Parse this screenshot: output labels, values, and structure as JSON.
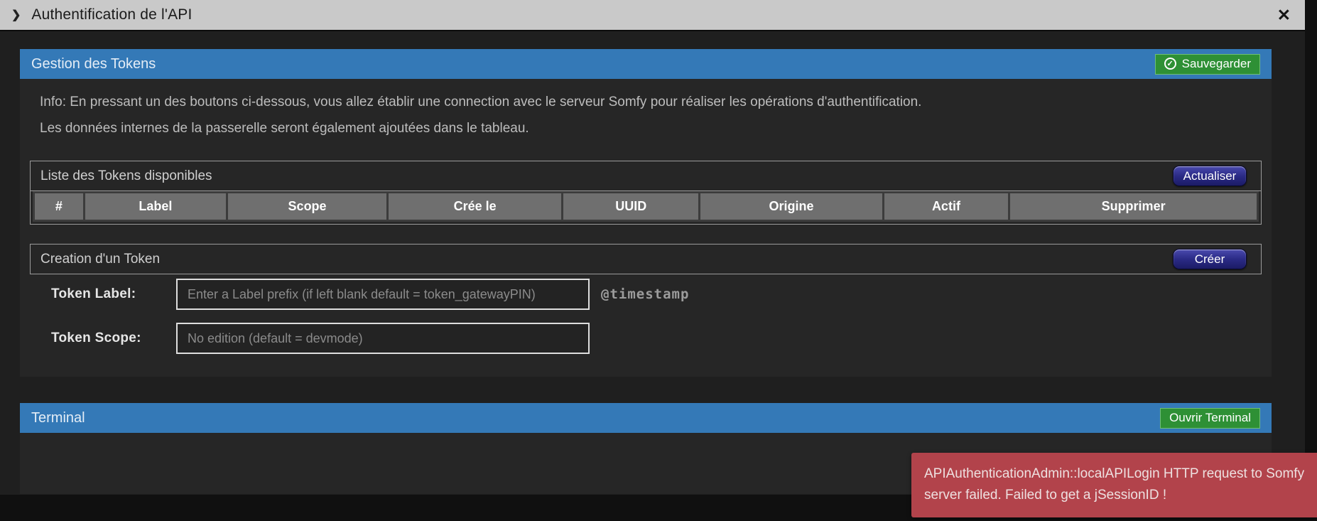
{
  "titlebar": {
    "title": "Authentification de l'API",
    "chevron_icon": "❯",
    "close_icon": "✕"
  },
  "panels": {
    "tokens": {
      "title": "Gestion des Tokens",
      "save_button": "Sauvegarder",
      "check_icon": "✓",
      "info_line1": "Info: En pressant un des boutons ci-dessous, vous allez établir une connection avec le serveur Somfy pour réaliser les opérations d'authentification.",
      "info_line2": "Les données internes de la passerelle seront également ajoutées dans le tableau.",
      "list": {
        "title": "Liste des Tokens disponibles",
        "refresh_button": "Actualiser",
        "columns": [
          "#",
          "Label",
          "Scope",
          "Crée le",
          "UUID",
          "Origine",
          "Actif",
          "Supprimer"
        ],
        "rows": []
      },
      "creation": {
        "title": "Creation d'un Token",
        "create_button": "Créer",
        "label_field": {
          "label": "Token Label:",
          "value": "",
          "placeholder": "Enter a Label prefix (if left blank default = token_gatewayPIN)",
          "suffix": "@timestamp"
        },
        "scope_field": {
          "label": "Token Scope:",
          "value": "",
          "placeholder": "No edition (default = devmode)"
        }
      }
    },
    "terminal": {
      "title": "Terminal",
      "open_button": "Ouvrir Terminal"
    }
  },
  "toast": {
    "message": "APIAuthenticationAdmin::localAPILogin HTTP request to Somfy server failed. Failed to get a jSessionID !"
  },
  "colors": {
    "titlebar_gray": "#c9c9c9",
    "accent_blue": "#3479b7",
    "button_green": "#2e9035",
    "button_navy": "#2b2b86",
    "table_header_gray": "#6f6f6f",
    "toast_red": "#b2434b",
    "panel_dark": "#262626"
  }
}
